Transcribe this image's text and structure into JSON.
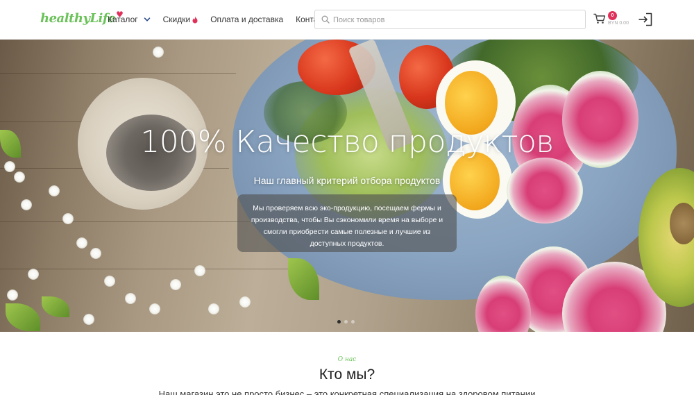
{
  "header": {
    "logo_text": "healthyLife",
    "logo_heart": "♥",
    "nav": [
      {
        "label": "Каталог",
        "icon": "chevron-down-icon"
      },
      {
        "label": "Скидки",
        "icon": "flame-icon"
      },
      {
        "label": "Оплата и доставка"
      },
      {
        "label": "Контакты"
      }
    ],
    "search": {
      "placeholder": "Поиск товаров",
      "value": ""
    },
    "cart": {
      "count": "0",
      "sum": "BYN 0.00"
    },
    "login_icon": "login-icon"
  },
  "hero": {
    "title": "100% Качество продуктов",
    "subtitle": "Наш главный критерий отбора продуктов",
    "description": "Мы проверяем всю эко-продукцию, посещаем фермы и производства, чтобы Вы сэкономили время на выборе и смогли приобрести самые полезные и лучшие из доступных продуктов.",
    "slides": 3,
    "active_slide": 1
  },
  "about": {
    "label": "О нас",
    "title": "Кто мы?",
    "text": "Наш магазин это не просто бизнес – это конкретная специализация на здоровом питании"
  },
  "colors": {
    "brand_green": "#6ac259",
    "accent_pink": "#e0315b"
  }
}
